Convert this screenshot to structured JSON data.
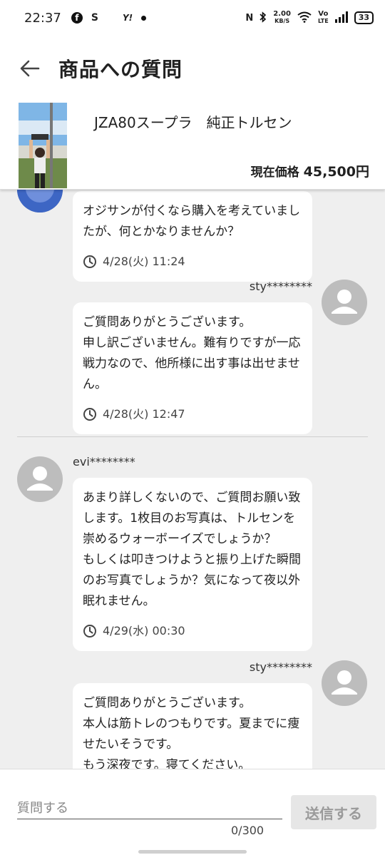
{
  "status_bar": {
    "time": "22:37",
    "s_label": "S",
    "y_label": "Y!",
    "rate_top": "2.00",
    "rate_bottom": "KB/S",
    "volte_top": "Vo",
    "volte_bottom": "LTE",
    "battery": "33"
  },
  "header": {
    "title": "商品への質問"
  },
  "product": {
    "name": "JZA80スープラ　純正トルセン",
    "price_label": "現在価格",
    "price": "45,500円"
  },
  "thread": [
    {
      "text": "オジサンが付くなら購入を考えていましたが、何とかなりませんか？",
      "timestamp": "4/28(火) 11:24"
    },
    {
      "user": "sty********",
      "text": "ご質問ありがとうございます。\n申し訳ございません。難有りですが一応戦力なので、他所様に出す事は出せません。",
      "timestamp": "4/28(火) 12:47"
    },
    {
      "user": "evi********",
      "text": "あまり詳しくないので、ご質問お願い致します。1枚目のお写真は、トルセンを崇めるウォーボーイズでしょうか？\nもしくは叩きつけようと振り上げた瞬間のお写真でしょうか？気になって夜以外眠れません。",
      "timestamp": "4/29(水) 00:30"
    },
    {
      "user": "sty********",
      "text": "ご質問ありがとうございます。\n本人は筋トレのつもりです。夏までに痩せたいそうです。\nもう深夜です。寝てください。",
      "timestamp": ""
    }
  ],
  "input": {
    "placeholder": "質問する",
    "counter": "0/300",
    "send_label": "送信する"
  },
  "colors": {
    "background": "#efefef",
    "avatar": "#bdbdbd",
    "send_disabled_bg": "#e6e6e6",
    "send_disabled_text": "#9a9a9a"
  }
}
